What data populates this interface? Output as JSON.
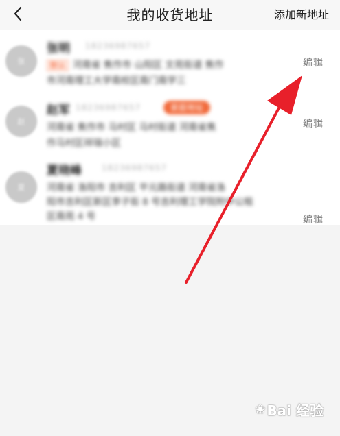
{
  "header": {
    "back_icon": "chevron-left-icon",
    "title": "我的收货地址",
    "add_label": "添加新地址"
  },
  "addresses": [
    {
      "avatar_text": "张",
      "name": "张明",
      "phone": "18236987657",
      "default_tag": "默认",
      "line1": "河南省 焦作市 山阳区 文苑街道 焦作",
      "line2": "市河南理工大学南校区南门南学三",
      "badge": "",
      "edit_label": "编辑"
    },
    {
      "avatar_text": "赵",
      "name": "赵军",
      "phone": "18236987657",
      "default_tag": "",
      "line1": "河南省 焦作市 马村区 马村街道 河南省焦",
      "line2": "作马村区祥瑞小区",
      "badge": "家庭地址",
      "edit_label": "编辑"
    },
    {
      "avatar_text": "夏",
      "name": "夏晓峰",
      "phone": "18236987657",
      "default_tag": "",
      "line1": "河南省 洛阳市 吉利区 平元路街道 河南省洛",
      "line2": "阳市吉利区新区李子街 8 号吉利理工学院附中公租",
      "line3": "区南苑 4 号",
      "badge": "",
      "edit_label": "编辑"
    }
  ],
  "colors": {
    "accent": "#f1693a",
    "arrow": "#e8202a"
  },
  "watermark": {
    "text": "Bai 经验"
  }
}
